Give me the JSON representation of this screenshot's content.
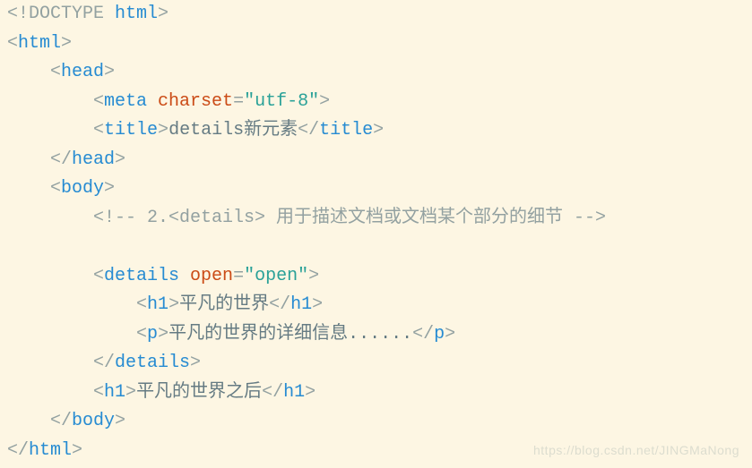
{
  "tokens": {
    "doctype_open": "<!DOCTYPE ",
    "doctype_name": "html",
    "doctype_close": ">",
    "html_open_b": "<",
    "html_tag": "html",
    "html_open_e": ">",
    "head_open_b": "<",
    "head_tag": "head",
    "head_open_e": ">",
    "meta_open_b": "<",
    "meta_tag": "meta",
    "meta_attr": " charset",
    "eq": "=",
    "meta_val": "\"utf-8\"",
    "meta_close": ">",
    "title_open_b": "<",
    "title_tag": "title",
    "title_open_e": ">",
    "title_text": "details新元素",
    "title_close_b": "</",
    "title_close_e": ">",
    "head_close_b": "</",
    "head_close_e": ">",
    "body_open_b": "<",
    "body_tag": "body",
    "body_open_e": ">",
    "comment": "<!-- 2.<details> 用于描述文档或文档某个部分的细节 -->",
    "details_open_b": "<",
    "details_tag": "details",
    "details_attr": " open",
    "details_val": "\"open\"",
    "details_open_e": ">",
    "h1_open_b": "<",
    "h1_tag": "h1",
    "h1_open_e": ">",
    "h1_text1": "平凡的世界",
    "h1_close_b": "</",
    "h1_close_e": ">",
    "p_open_b": "<",
    "p_tag": "p",
    "p_open_e": ">",
    "p_text": "平凡的世界的详细信息......",
    "p_close_b": "</",
    "p_close_e": ">",
    "details_close_b": "</",
    "details_close_e": ">",
    "h1_text2": "平凡的世界之后",
    "body_close_b": "</",
    "body_close_e": ">",
    "html_close_b": "</",
    "html_close_e": ">"
  },
  "watermark": "https://blog.csdn.net/JINGMaNong"
}
